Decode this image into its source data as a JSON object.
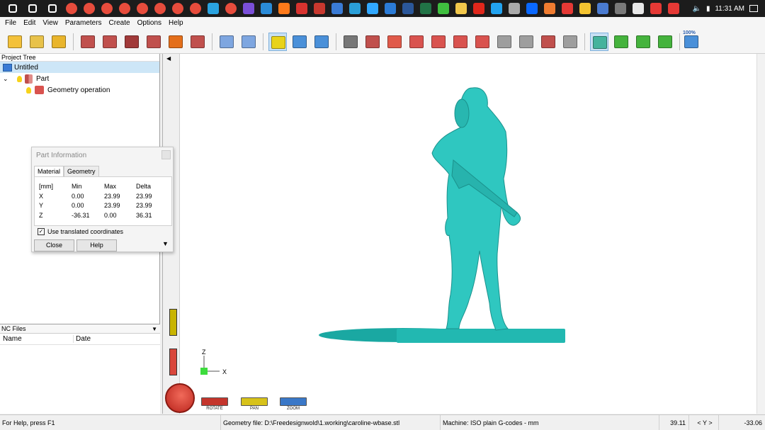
{
  "taskbar": {
    "icons": [
      {
        "name": "windows-start-icon",
        "color": "#ffffff"
      },
      {
        "name": "search-icon",
        "color": "#ffffff"
      },
      {
        "name": "task-view-icon",
        "color": "#ffffff"
      },
      {
        "name": "chrome-icon",
        "color": "#e74c3c"
      },
      {
        "name": "chrome-icon",
        "color": "#e74c3c"
      },
      {
        "name": "chrome-icon",
        "color": "#e74c3c"
      },
      {
        "name": "chrome-icon",
        "color": "#e74c3c"
      },
      {
        "name": "chrome-icon",
        "color": "#e74c3c"
      },
      {
        "name": "chrome-icon",
        "color": "#e74c3c"
      },
      {
        "name": "chrome-icon",
        "color": "#e74c3c"
      },
      {
        "name": "chrome-icon",
        "color": "#e74c3c"
      },
      {
        "name": "telegram-icon",
        "color": "#2aa3e0"
      },
      {
        "name": "chrome-icon",
        "color": "#e74c3c"
      },
      {
        "name": "media-icon",
        "color": "#7a4fd8"
      },
      {
        "name": "app-icon",
        "color": "#2a8bd8"
      },
      {
        "name": "app-icon",
        "color": "#ff7a1a"
      },
      {
        "name": "app-icon",
        "color": "#d8332f"
      },
      {
        "name": "app-icon",
        "color": "#c8382e"
      },
      {
        "name": "app-icon",
        "color": "#3a7bd5"
      },
      {
        "name": "app-icon",
        "color": "#2a9fd8"
      },
      {
        "name": "photoshop-icon",
        "color": "#31a8ff"
      },
      {
        "name": "app-icon",
        "color": "#2b7bd6"
      },
      {
        "name": "word-icon",
        "color": "#2b579a"
      },
      {
        "name": "excel-icon",
        "color": "#217346"
      },
      {
        "name": "app-icon",
        "color": "#3fbf3f"
      },
      {
        "name": "folder-icon",
        "color": "#f2c84b"
      },
      {
        "name": "acrobat-icon",
        "color": "#e0271b"
      },
      {
        "name": "vscode-icon",
        "color": "#22a3f0"
      },
      {
        "name": "app-icon",
        "color": "#aaaaaa"
      },
      {
        "name": "zalo-icon",
        "color": "#0a68ff"
      },
      {
        "name": "app-icon",
        "color": "#f07c30"
      },
      {
        "name": "app-icon",
        "color": "#e53935"
      },
      {
        "name": "app-icon",
        "color": "#f4c430"
      },
      {
        "name": "app-icon",
        "color": "#4a7bd0"
      },
      {
        "name": "app-icon",
        "color": "#7a7a7a"
      },
      {
        "name": "app-icon",
        "color": "#e8e8e8"
      },
      {
        "name": "app-icon",
        "color": "#e53935"
      },
      {
        "name": "app-icon",
        "color": "#e53935"
      }
    ],
    "tray": {
      "time": "11:31 AM"
    }
  },
  "menu": {
    "items": [
      "File",
      "Edit",
      "View",
      "Parameters",
      "Create",
      "Options",
      "Help"
    ]
  },
  "toolbar": {
    "tools": [
      {
        "name": "new-file-icon",
        "color": "#f3c13a",
        "active": false
      },
      {
        "name": "open-folder-icon",
        "color": "#e8c24a",
        "active": false
      },
      {
        "name": "save-icon",
        "color": "#e9b52c",
        "active": false
      },
      {
        "name": "import-icon",
        "color": "#c0504d",
        "active": false
      },
      {
        "name": "pipette-icon",
        "color": "#c0504d",
        "active": false
      },
      {
        "name": "probe-icon",
        "color": "#a13a3a",
        "active": false
      },
      {
        "name": "drill-icon",
        "color": "#c0504d",
        "active": false
      },
      {
        "name": "d-tool-icon",
        "color": "#e46f1b",
        "active": false
      },
      {
        "name": "export-icon",
        "color": "#c0504d",
        "active": false
      },
      {
        "name": "material-icon",
        "color": "#7ea6e0",
        "active": false
      },
      {
        "name": "zoom-search-icon",
        "color": "#7ea6e0",
        "active": false
      },
      {
        "name": "info-icon",
        "color": "#e8d31a",
        "active": true
      },
      {
        "name": "layout-icon",
        "color": "#4a90d9",
        "active": false
      },
      {
        "name": "window-icon",
        "color": "#4a90d9",
        "active": false
      },
      {
        "name": "camera-icon",
        "color": "#777777",
        "active": false
      },
      {
        "name": "view-cube-icon",
        "color": "#c0504d",
        "active": false
      },
      {
        "name": "view-front-icon",
        "color": "#e05a4a",
        "active": false
      },
      {
        "name": "view-side-icon",
        "color": "#d9534f",
        "active": false
      },
      {
        "name": "view-top-icon",
        "color": "#d9534f",
        "active": false
      },
      {
        "name": "view-iso-icon",
        "color": "#d9534f",
        "active": false
      },
      {
        "name": "view-back-icon",
        "color": "#d9534f",
        "active": false
      },
      {
        "name": "view-bottom-icon",
        "color": "#9e9e9e",
        "active": false
      },
      {
        "name": "view-left-icon",
        "color": "#9e9e9e",
        "active": false
      },
      {
        "name": "snapshot-icon",
        "color": "#c0504d",
        "active": false
      },
      {
        "name": "snapshot2-icon",
        "color": "#9e9e9e",
        "active": false
      },
      {
        "name": "rotate-view-icon",
        "color": "#45b39d",
        "active": true
      },
      {
        "name": "pan-icon",
        "color": "#45b33d",
        "active": false
      },
      {
        "name": "zoom-in-icon",
        "color": "#45b33d",
        "active": false
      },
      {
        "name": "zoom-window-icon",
        "color": "#45b33d",
        "active": false
      },
      {
        "name": "zoom-100-icon",
        "color": "#4a90d9",
        "active": false
      }
    ],
    "zoom_label": "100%"
  },
  "project_tree": {
    "header": "Project Tree",
    "root": "Untitled",
    "part": "Part",
    "operation": "Geometry operation"
  },
  "part_info": {
    "title": "Part Information",
    "tabs": [
      "Material",
      "Geometry"
    ],
    "columns": [
      "[mm]",
      "Min",
      "Max",
      "Delta"
    ],
    "rows": [
      {
        "axis": "X",
        "min": "0.00",
        "max": "23.99",
        "delta": "23.99"
      },
      {
        "axis": "Y",
        "min": "0.00",
        "max": "23.99",
        "delta": "23.99"
      },
      {
        "axis": "Z",
        "min": "-36.31",
        "max": "0.00",
        "delta": "36.31"
      }
    ],
    "checkbox_label": "Use translated coordinates",
    "checkbox_checked": true,
    "close_label": "Close",
    "help_label": "Help"
  },
  "nc_files": {
    "header": "NC Files",
    "columns": [
      "Name",
      "Date"
    ]
  },
  "viewport": {
    "model_color": "#2fc7c0",
    "axis_z": "Z",
    "axis_x": "X",
    "nav_labels": [
      "ROTATE",
      "PAN",
      "ZOOM"
    ]
  },
  "status": {
    "help": "For Help, press F1",
    "geometry_file": "Geometry file: D:\\Freedesignwold\\1.working\\caroline-wbase.stl",
    "machine": "Machine: ISO plain G-codes - mm",
    "coord_x": "39.11",
    "coord_axis": "< Y >",
    "coord_y": "-33.06"
  }
}
